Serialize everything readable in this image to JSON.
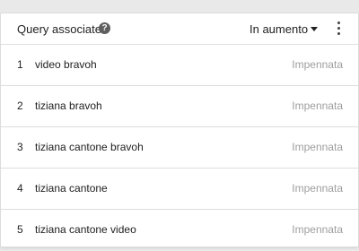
{
  "widget": {
    "title": "Query associate",
    "help_icon": "help-icon",
    "help_glyph": "?",
    "sort_label": "In aumento",
    "dropdown_icon": "arrow-drop-down-icon",
    "menu_icon": "more-vert-icon"
  },
  "rows": [
    {
      "rank": "1",
      "query": "video bravoh",
      "status": "Impennata"
    },
    {
      "rank": "2",
      "query": "tiziana bravoh",
      "status": "Impennata"
    },
    {
      "rank": "3",
      "query": "tiziana cantone bravoh",
      "status": "Impennata"
    },
    {
      "rank": "4",
      "query": "tiziana cantone",
      "status": "Impennata"
    },
    {
      "rank": "5",
      "query": "tiziana cantone video",
      "status": "Impennata"
    }
  ],
  "colors": {
    "text": "#212121",
    "status_text": "#9e9e9e",
    "background": "#e9e9e9",
    "card": "#ffffff"
  }
}
